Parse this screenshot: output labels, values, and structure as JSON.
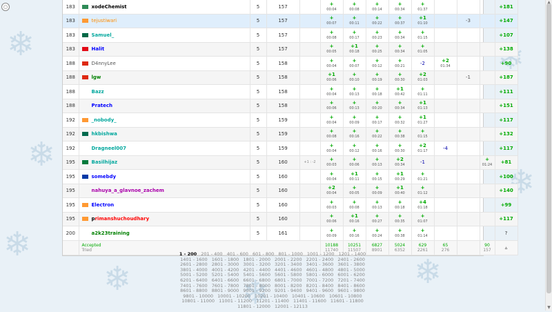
{
  "rows": [
    {
      "rank": "183",
      "handle": "xodeChemist",
      "color": "c-black",
      "flag": "#2e8b57",
      "solved": "5",
      "penalty": "157",
      "hack": "",
      "probs": [
        {
          "s": "+",
          "t": "00:04"
        },
        {
          "s": "+",
          "t": "00:08"
        },
        {
          "s": "+",
          "t": "00:14"
        },
        {
          "s": "+",
          "t": "00:34"
        },
        {
          "s": "+",
          "t": "01:37"
        },
        {
          "s": "",
          "t": ""
        },
        {
          "s": "",
          "t": ""
        }
      ],
      "hack_neg": "",
      "score": "+181"
    },
    {
      "rank": "183",
      "handle": "tejustiwari",
      "color": "c-orange",
      "flag": "#ff9933",
      "solved": "5",
      "penalty": "157",
      "hack": "",
      "probs": [
        {
          "s": "+",
          "t": "00:07"
        },
        {
          "s": "+",
          "t": "00:11"
        },
        {
          "s": "+",
          "t": "00:22"
        },
        {
          "s": "+",
          "t": "00:37"
        },
        {
          "s": "+1",
          "t": "01:10"
        },
        {
          "s": "",
          "t": ""
        },
        {
          "s": "",
          "t": ""
        }
      ],
      "hack_neg": "-3",
      "score": "+147"
    },
    {
      "rank": "183",
      "handle": "Samuel_",
      "color": "c-cyan",
      "flag": "#006847",
      "solved": "5",
      "penalty": "157",
      "hack": "",
      "probs": [
        {
          "s": "+",
          "t": "00:08"
        },
        {
          "s": "+",
          "t": "00:17"
        },
        {
          "s": "+",
          "t": "00:23"
        },
        {
          "s": "+",
          "t": "00:34"
        },
        {
          "s": "+",
          "t": "01:15"
        },
        {
          "s": "",
          "t": ""
        },
        {
          "s": "",
          "t": ""
        }
      ],
      "hack_neg": "",
      "score": "+107"
    },
    {
      "rank": "183",
      "handle": "Halit",
      "color": "c-blue",
      "flag": "#e30a17",
      "solved": "5",
      "penalty": "157",
      "hack": "",
      "probs": [
        {
          "s": "+",
          "t": "00:05"
        },
        {
          "s": "+1",
          "t": "00:18"
        },
        {
          "s": "+",
          "t": "00:25"
        },
        {
          "s": "+",
          "t": "00:34"
        },
        {
          "s": "+",
          "t": "01:05"
        },
        {
          "s": "",
          "t": ""
        },
        {
          "s": "",
          "t": ""
        }
      ],
      "hack_neg": "",
      "score": "+138"
    },
    {
      "rank": "188",
      "handle": "D4nnyLee",
      "color": "c-gray",
      "flag": "#de2910",
      "solved": "5",
      "penalty": "158",
      "hack": "",
      "probs": [
        {
          "s": "+",
          "t": "00:04"
        },
        {
          "s": "+",
          "t": "00:07"
        },
        {
          "s": "+",
          "t": "00:12"
        },
        {
          "s": "+",
          "t": "00:21"
        },
        {
          "s": "-2",
          "t": ""
        },
        {
          "s": "+2",
          "t": "01:34"
        },
        {
          "s": "",
          "t": ""
        }
      ],
      "hack_neg": "",
      "score": "+90"
    },
    {
      "rank": "188",
      "handle": "lgw",
      "color": "c-green",
      "flag": "#de2910",
      "solved": "5",
      "penalty": "158",
      "hack": "",
      "probs": [
        {
          "s": "+1",
          "t": "00:06"
        },
        {
          "s": "+",
          "t": "00:10"
        },
        {
          "s": "+",
          "t": "00:19"
        },
        {
          "s": "+",
          "t": "00:30"
        },
        {
          "s": "+2",
          "t": "01:03"
        },
        {
          "s": "",
          "t": ""
        },
        {
          "s": "",
          "t": ""
        }
      ],
      "hack_neg": "-1",
      "score": "+187"
    },
    {
      "rank": "188",
      "handle": "Bazz",
      "color": "c-cyan",
      "flag": "",
      "solved": "5",
      "penalty": "158",
      "hack": "",
      "probs": [
        {
          "s": "+",
          "t": "00:04"
        },
        {
          "s": "+",
          "t": "00:13"
        },
        {
          "s": "+",
          "t": "00:18"
        },
        {
          "s": "+1",
          "t": "00:42"
        },
        {
          "s": "+",
          "t": "01:11"
        },
        {
          "s": "",
          "t": ""
        },
        {
          "s": "",
          "t": ""
        }
      ],
      "hack_neg": "",
      "score": "+111"
    },
    {
      "rank": "188",
      "handle": "Pratech",
      "color": "c-blue",
      "flag": "",
      "solved": "5",
      "penalty": "158",
      "hack": "",
      "probs": [
        {
          "s": "+",
          "t": "00:06"
        },
        {
          "s": "+",
          "t": "00:13"
        },
        {
          "s": "+",
          "t": "00:20"
        },
        {
          "s": "+",
          "t": "00:34"
        },
        {
          "s": "+1",
          "t": "01:13"
        },
        {
          "s": "",
          "t": ""
        },
        {
          "s": "",
          "t": ""
        }
      ],
      "hack_neg": "",
      "score": "+151"
    },
    {
      "rank": "192",
      "handle": "_nobody_",
      "color": "c-cyan",
      "flag": "#ff9933",
      "solved": "5",
      "penalty": "159",
      "hack": "",
      "probs": [
        {
          "s": "+",
          "t": "00:04"
        },
        {
          "s": "+",
          "t": "00:09"
        },
        {
          "s": "+",
          "t": "00:17"
        },
        {
          "s": "+",
          "t": "00:32"
        },
        {
          "s": "+1",
          "t": "01:27"
        },
        {
          "s": "",
          "t": ""
        },
        {
          "s": "",
          "t": ""
        }
      ],
      "hack_neg": "",
      "score": "+117"
    },
    {
      "rank": "192",
      "handle": "hkbishwa",
      "color": "c-cyan",
      "flag": "#006a4e",
      "solved": "5",
      "penalty": "159",
      "hack": "",
      "probs": [
        {
          "s": "+",
          "t": "00:08"
        },
        {
          "s": "+",
          "t": "00:16"
        },
        {
          "s": "+",
          "t": "00:22"
        },
        {
          "s": "+",
          "t": "00:38"
        },
        {
          "s": "+",
          "t": "01:15"
        },
        {
          "s": "",
          "t": ""
        },
        {
          "s": "",
          "t": ""
        }
      ],
      "hack_neg": "",
      "score": "+132"
    },
    {
      "rank": "192",
      "handle": "Dragneel007",
      "color": "c-cyan",
      "flag": "",
      "solved": "5",
      "penalty": "159",
      "hack": "",
      "probs": [
        {
          "s": "+",
          "t": "00:04"
        },
        {
          "s": "+",
          "t": "00:12"
        },
        {
          "s": "+",
          "t": "00:16"
        },
        {
          "s": "+",
          "t": "00:30"
        },
        {
          "s": "+2",
          "t": "01:17"
        },
        {
          "s": "-4",
          "t": ""
        },
        {
          "s": "",
          "t": ""
        }
      ],
      "hack_neg": "",
      "score": "+117"
    },
    {
      "rank": "195",
      "handle": "Basilhijaz",
      "color": "c-cyan",
      "flag": "#007a3d",
      "solved": "5",
      "penalty": "160",
      "hack": "+1 : -2",
      "probs": [
        {
          "s": "+",
          "t": "00:03"
        },
        {
          "s": "+",
          "t": "00:06"
        },
        {
          "s": "+",
          "t": "00:13"
        },
        {
          "s": "+2",
          "t": "00:34"
        },
        {
          "s": "-1",
          "t": ""
        },
        {
          "s": "",
          "t": ""
        },
        {
          "s": "+",
          "t": "01:24"
        }
      ],
      "hack_neg": "",
      "score": "+81"
    },
    {
      "rank": "195",
      "handle": "somebdy",
      "color": "c-blue",
      "flag": "#0039a6",
      "solved": "5",
      "penalty": "160",
      "hack": "",
      "probs": [
        {
          "s": "+",
          "t": "00:04"
        },
        {
          "s": "+1",
          "t": "00:11"
        },
        {
          "s": "+",
          "t": "00:15"
        },
        {
          "s": "+1",
          "t": "00:29"
        },
        {
          "s": "+",
          "t": "01:21"
        },
        {
          "s": "",
          "t": ""
        },
        {
          "s": "",
          "t": ""
        }
      ],
      "hack_neg": "",
      "score": "+100"
    },
    {
      "rank": "195",
      "handle": "nahuya_a_glavnoe_zachem",
      "color": "c-violet",
      "flag": "",
      "solved": "5",
      "penalty": "160",
      "hack": "",
      "probs": [
        {
          "s": "+2",
          "t": "00:04"
        },
        {
          "s": "+",
          "t": "00:05"
        },
        {
          "s": "+",
          "t": "00:09"
        },
        {
          "s": "+1",
          "t": "00:40"
        },
        {
          "s": "+",
          "t": "01:12"
        },
        {
          "s": "",
          "t": ""
        },
        {
          "s": "",
          "t": ""
        }
      ],
      "hack_neg": "",
      "score": "+140"
    },
    {
      "rank": "195",
      "handle": "Electron",
      "color": "c-blue",
      "flag": "#ff9933",
      "solved": "5",
      "penalty": "160",
      "hack": "",
      "probs": [
        {
          "s": "+",
          "t": "00:03"
        },
        {
          "s": "+",
          "t": "00:08"
        },
        {
          "s": "+",
          "t": "00:13"
        },
        {
          "s": "+",
          "t": "00:18"
        },
        {
          "s": "+4",
          "t": "01:18"
        },
        {
          "s": "",
          "t": ""
        },
        {
          "s": "",
          "t": ""
        }
      ],
      "hack_neg": "",
      "score": "+99"
    },
    {
      "rank": "195",
      "handle": "primanshuchoudhary",
      "color": "red-first",
      "flag": "#ff9933",
      "solved": "5",
      "penalty": "160",
      "hack": "",
      "probs": [
        {
          "s": "+",
          "t": "00:06"
        },
        {
          "s": "+1",
          "t": "00:16"
        },
        {
          "s": "+",
          "t": "00:27"
        },
        {
          "s": "+",
          "t": "00:35"
        },
        {
          "s": "+",
          "t": "01:07"
        },
        {
          "s": "",
          "t": ""
        },
        {
          "s": "",
          "t": ""
        }
      ],
      "hack_neg": "",
      "score": "+117"
    },
    {
      "rank": "200",
      "handle": "a2k23training",
      "color": "c-green",
      "flag": "",
      "solved": "5",
      "penalty": "161",
      "hack": "",
      "probs": [
        {
          "s": "+",
          "t": "00:09"
        },
        {
          "s": "+",
          "t": "00:16"
        },
        {
          "s": "+",
          "t": "00:24"
        },
        {
          "s": "+",
          "t": "00:38"
        },
        {
          "s": "+",
          "t": "01:14"
        },
        {
          "s": "",
          "t": ""
        },
        {
          "s": "",
          "t": ""
        }
      ],
      "hack_neg": "",
      "score": "?"
    }
  ],
  "summary": {
    "accepted_label": "Accepted",
    "tried_label": "Tried",
    "accepted": [
      "10188",
      "10251",
      "6827",
      "5024",
      "629",
      "65",
      "90"
    ],
    "tried": [
      "11740",
      "11507",
      "8901",
      "6352",
      "2261",
      "276",
      "157"
    ],
    "toggle": "▵"
  },
  "pagination": [
    "1 - 200",
    "201 - 400",
    "401 - 600",
    "601 - 800",
    "801 - 1000",
    "1001 - 1200",
    "1201 - 1400",
    "1401 - 1600",
    "1601 - 1800",
    "1801 - 2000",
    "2001 - 2200",
    "2201 - 2400",
    "2401 - 2600",
    "2601 - 2800",
    "2801 - 3000",
    "3001 - 3200",
    "3201 - 3400",
    "3401 - 3600",
    "3601 - 3800",
    "3801 - 4000",
    "4001 - 4200",
    "4201 - 4400",
    "4401 - 4600",
    "4601 - 4800",
    "4801 - 5000",
    "5001 - 5200",
    "5201 - 5400",
    "5401 - 5600",
    "5601 - 5800",
    "5801 - 6000",
    "6001 - 6200",
    "6201 - 6400",
    "6401 - 6600",
    "6601 - 6800",
    "6801 - 7000",
    "7001 - 7200",
    "7201 - 7400",
    "7401 - 7600",
    "7601 - 7800",
    "7801 - 8000",
    "8001 - 8200",
    "8201 - 8400",
    "8401 - 8600",
    "8601 - 8800",
    "8801 - 9000",
    "9001 - 9200",
    "9201 - 9400",
    "9401 - 9600",
    "9601 - 9800",
    "9801 - 10000",
    "10001 - 10200",
    "10201 - 10400",
    "10401 - 10600",
    "10601 - 10800",
    "10801 - 11000",
    "11001 - 11200",
    "11201 - 11400",
    "11401 - 11600",
    "11601 - 11800",
    "11801 - 12000",
    "12001 - 12113"
  ],
  "pagination_active": 0,
  "ui": {
    "up_arrow": "▲",
    "down_arrow": "▼",
    "top_icon": "○",
    "snowflake": "❄"
  }
}
